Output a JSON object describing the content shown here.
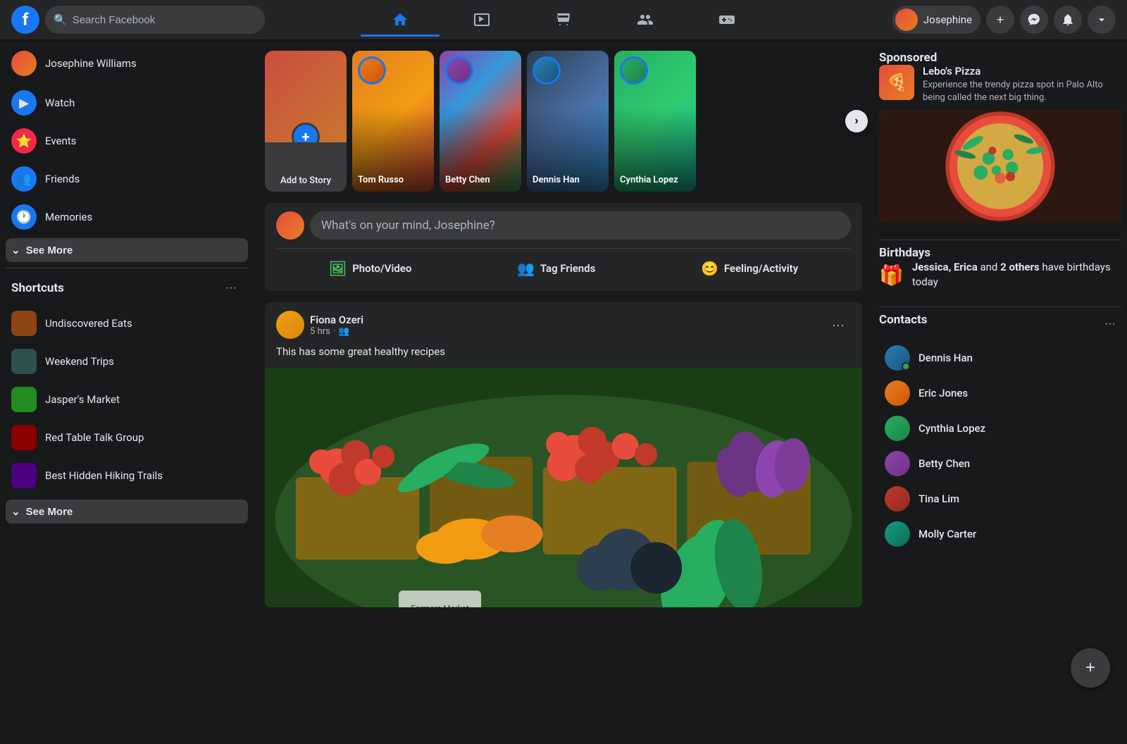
{
  "topnav": {
    "logo": "f",
    "search_placeholder": "Search Facebook",
    "user_name": "Josephine",
    "nav_items": [
      {
        "id": "home",
        "label": "Home",
        "icon": "🏠",
        "active": true
      },
      {
        "id": "watch",
        "label": "Watch",
        "icon": "▶",
        "active": false
      },
      {
        "id": "marketplace",
        "label": "Marketplace",
        "icon": "🏪",
        "active": false
      },
      {
        "id": "groups",
        "label": "Groups",
        "icon": "👥",
        "active": false
      },
      {
        "id": "gaming",
        "label": "Gaming",
        "icon": "🎮",
        "active": false
      }
    ],
    "action_buttons": [
      {
        "id": "create",
        "icon": "+",
        "label": "Create"
      },
      {
        "id": "messenger",
        "icon": "💬",
        "label": "Messenger"
      },
      {
        "id": "notifications",
        "icon": "🔔",
        "label": "Notifications"
      },
      {
        "id": "menu",
        "icon": "▼",
        "label": "Menu"
      }
    ]
  },
  "sidebar_left": {
    "user": {
      "name": "Josephine Williams",
      "avatar_class": "av-josephine"
    },
    "nav_items": [
      {
        "id": "watch",
        "label": "Watch",
        "icon": "▶",
        "icon_class": "icon-watch"
      },
      {
        "id": "events",
        "label": "Events",
        "icon": "⭐",
        "icon_class": "icon-events"
      },
      {
        "id": "friends",
        "label": "Friends",
        "icon": "👥",
        "icon_class": "icon-friends"
      },
      {
        "id": "memories",
        "label": "Memories",
        "icon": "🕐",
        "icon_class": "icon-memories"
      }
    ],
    "see_more_label": "See More",
    "shortcuts_title": "Shortcuts",
    "shortcuts": [
      {
        "id": "undiscovered-eats",
        "label": "Undiscovered Eats",
        "bg": "#8B4513"
      },
      {
        "id": "weekend-trips",
        "label": "Weekend Trips",
        "bg": "#2F4F4F"
      },
      {
        "id": "jaspers-market",
        "label": "Jasper's Market",
        "bg": "#228B22"
      },
      {
        "id": "red-table-talk",
        "label": "Red Table Talk Group",
        "bg": "#8B0000"
      },
      {
        "id": "hidden-hiking",
        "label": "Best Hidden Hiking Trails",
        "bg": "#4B0082"
      }
    ],
    "shortcuts_see_more_label": "See More"
  },
  "stories": {
    "add_story": {
      "label": "Add to Story",
      "plus_icon": "+"
    },
    "items": [
      {
        "id": "tom-russo",
        "name": "Tom Russo",
        "av_class": "av-2"
      },
      {
        "id": "betty-chen",
        "name": "Betty Chen",
        "av_class": "av-3"
      },
      {
        "id": "dennis-han",
        "name": "Dennis Han",
        "av_class": "av-4"
      },
      {
        "id": "cynthia-lopez",
        "name": "Cynthia Lopez",
        "av_class": "av-5"
      }
    ],
    "next_btn": "›"
  },
  "composer": {
    "placeholder": "What's on your mind, Josephine?",
    "actions": [
      {
        "id": "photo-video",
        "label": "Photo/Video",
        "icon": "🖼",
        "color": "#45bd62"
      },
      {
        "id": "tag-friends",
        "label": "Tag Friends",
        "icon": "👥",
        "color": "#1877f2"
      },
      {
        "id": "feeling",
        "label": "Feeling/Activity",
        "icon": "😊",
        "color": "#f7b928"
      }
    ]
  },
  "posts": [
    {
      "id": "post-1",
      "author": "Fiona Ozeri",
      "avatar_class": "av-6",
      "time": "5 hrs",
      "visibility": "👥",
      "text": "This has some great healthy recipes",
      "has_image": true
    }
  ],
  "sidebar_right": {
    "sponsored": {
      "title": "Sponsored",
      "name": "Lebo's Pizza",
      "description": "Experience the trendy pizza spot in Palo Alto being called the next big thing.",
      "icon": "🍕"
    },
    "birthdays": {
      "title": "Birthdays",
      "icon": "🎁",
      "text_prefix": "",
      "bold_names": "Jessica, Erica",
      "text_suffix": " and ",
      "others_count": "2 others",
      "text_end": " have birthdays today"
    },
    "contacts": {
      "title": "Contacts",
      "items": [
        {
          "id": "dennis-han",
          "name": "Dennis Han",
          "online": true,
          "av_class": "av-4"
        },
        {
          "id": "eric-jones",
          "name": "Eric Jones",
          "online": false,
          "av_class": "av-2"
        },
        {
          "id": "cynthia-lopez",
          "name": "Cynthia Lopez",
          "online": false,
          "av_class": "av-5"
        },
        {
          "id": "betty-chen",
          "name": "Betty Chen",
          "online": false,
          "av_class": "av-3"
        },
        {
          "id": "tina-lim",
          "name": "Tina Lim",
          "online": false,
          "av_class": "av-8"
        },
        {
          "id": "molly-carter",
          "name": "Molly Carter",
          "online": false,
          "av_class": "av-7"
        }
      ]
    }
  },
  "float_btn": {
    "icon": "+"
  }
}
